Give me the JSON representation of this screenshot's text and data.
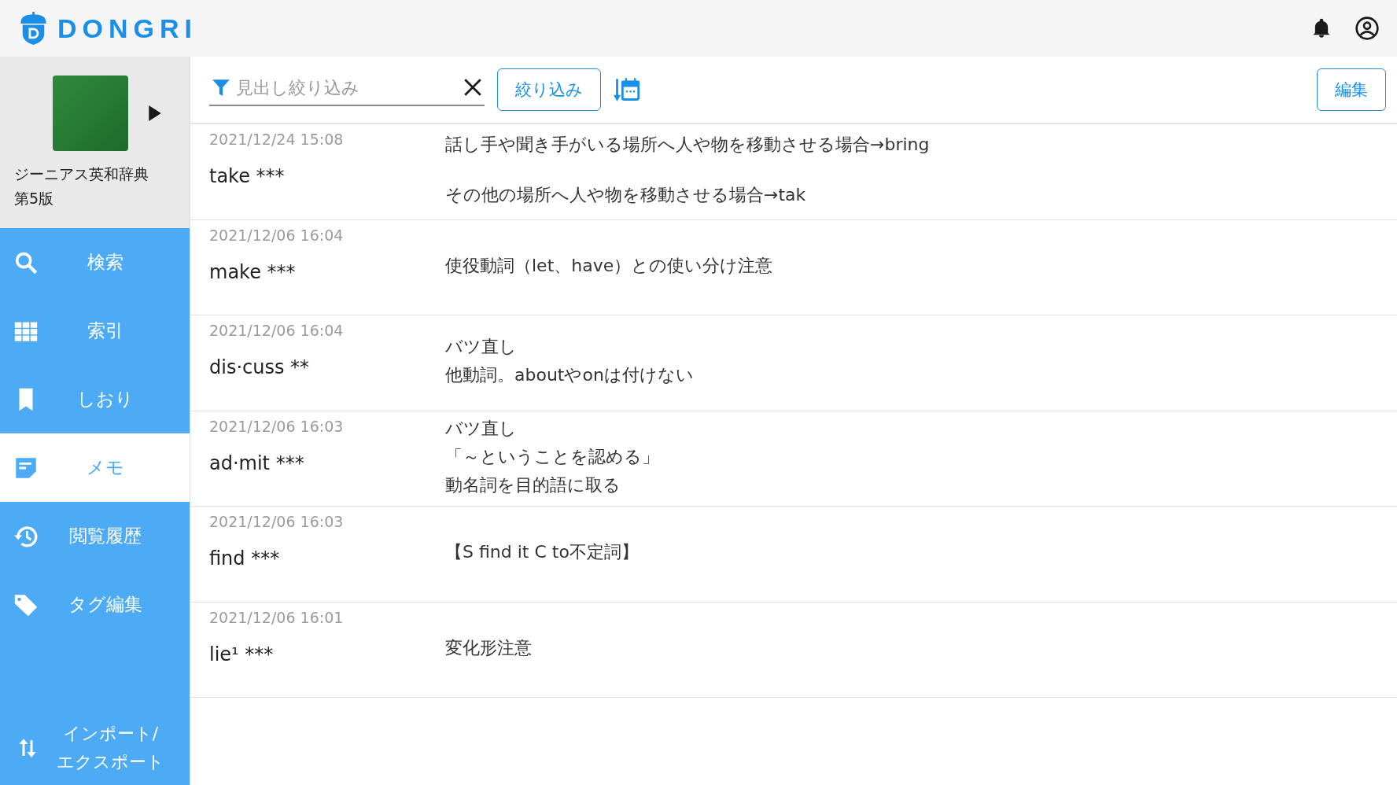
{
  "header": {
    "logo_text": "DONGRI"
  },
  "book": {
    "title_lines": [
      "ジーニアス英和辞典",
      "第5版"
    ]
  },
  "sidebar": {
    "items": [
      {
        "label": "検索",
        "selected": false
      },
      {
        "label": "索引",
        "selected": false
      },
      {
        "label": "しおり",
        "selected": false
      },
      {
        "label": "メモ",
        "selected": true
      },
      {
        "label": "閲覧履歴",
        "selected": false
      },
      {
        "label": "タグ編集",
        "selected": false
      }
    ],
    "bottom_item": {
      "label_lines": [
        "インポート/",
        "エクスポート"
      ]
    }
  },
  "toolbar": {
    "filter": {
      "placeholder": "見出し絞り込み"
    },
    "filter_button": "絞り込み",
    "edit_button": "編集"
  },
  "memos": [
    {
      "date": "2021/12/24 15:08",
      "headword": "take ***",
      "paragraphs": [
        [
          "話し手や聞き手がいる場所へ人や物を移動させる場合→bring"
        ],
        [
          "その他の場所へ人や物を移動させる場合→tak"
        ]
      ]
    },
    {
      "date": "2021/12/06 16:04",
      "headword": "make ***",
      "paragraphs": [
        [
          "使役動詞（let、have）との使い分け注意"
        ]
      ]
    },
    {
      "date": "2021/12/06 16:04",
      "headword": "dis·cuss **",
      "paragraphs": [
        [
          "バツ直し",
          "他動詞。aboutやonは付けない"
        ]
      ]
    },
    {
      "date": "2021/12/06 16:03",
      "headword": "ad·mit ***",
      "paragraphs": [
        [
          "バツ直し",
          "「～ということを認める」",
          "動名詞を目的語に取る"
        ]
      ]
    },
    {
      "date": "2021/12/06 16:03",
      "headword": "find ***",
      "paragraphs": [
        [
          "【S find it C to不定詞】"
        ]
      ]
    },
    {
      "date": "2021/12/06 16:01",
      "headword": "lie¹ ***",
      "paragraphs": [
        [
          "変化形注意"
        ]
      ]
    }
  ]
}
